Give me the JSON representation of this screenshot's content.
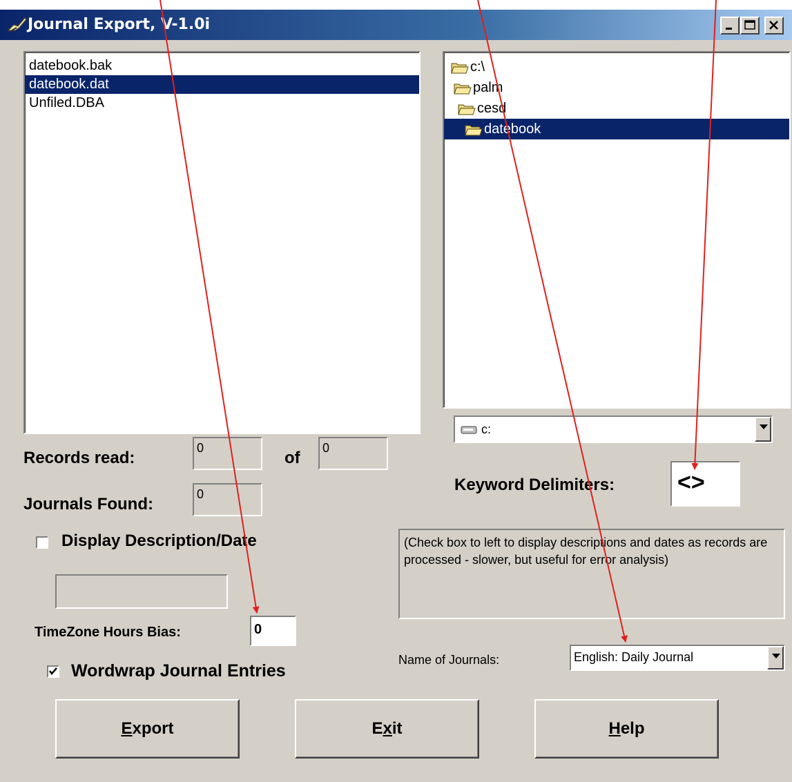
{
  "window": {
    "title": "Journal Export, V-1.0i",
    "controls": [
      "minimize",
      "maximize",
      "close"
    ]
  },
  "files": {
    "items": [
      "datebook.bak",
      "datebook.dat",
      "Unfiled.DBA"
    ],
    "selected_index": 1
  },
  "folders": {
    "items": [
      "c:\\",
      "palm",
      "cesd",
      "datebook"
    ],
    "selected_index": 3
  },
  "drive": {
    "value": "c:"
  },
  "records": {
    "label": "Records read:",
    "read": "0",
    "of_label": "of",
    "total": "0"
  },
  "journals": {
    "label": "Journals Found:",
    "value": "0"
  },
  "display_desc": {
    "label": "Display Description/Date",
    "checked": false,
    "value": ""
  },
  "timezone": {
    "label": "TimeZone Hours Bias:",
    "value": "0"
  },
  "wordwrap": {
    "label": "Wordwrap Journal Entries",
    "checked": true
  },
  "keyword": {
    "label": "Keyword Delimiters:",
    "value": "<>"
  },
  "info": {
    "text": "(Check box to left to display descriptions and dates as records are processed - slower, but useful for error analysis)"
  },
  "journal_name": {
    "label": "Name of Journals:",
    "value": "English: Daily Journal"
  },
  "buttons": {
    "export": {
      "pre": "",
      "u": "E",
      "post": "xport"
    },
    "exit": {
      "pre": "E",
      "u": "x",
      "post": "it"
    },
    "help": {
      "pre": "",
      "u": "H",
      "post": "elp"
    }
  },
  "colors": {
    "arrow": "#e0201c",
    "selection": "#0a246a",
    "face": "#d4d0c8"
  }
}
